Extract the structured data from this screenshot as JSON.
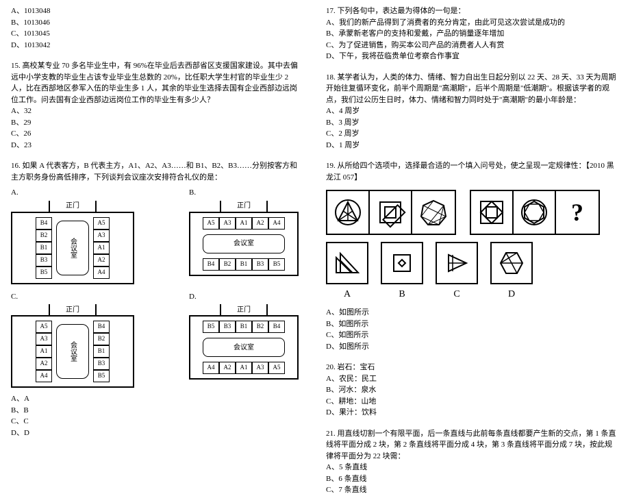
{
  "q14": {
    "opts": [
      "A、1013048",
      "B、1013046",
      "C、1013045",
      "D、1013042"
    ]
  },
  "q15": {
    "stem": "15. 高校某专业 70 多名毕业生中，有 96%在毕业后去西部省区支援国家建设。其中去偏远中小学支教的毕业生占该专业毕业生总数的 20%，比任职大学生村官的毕业生少 2 人，比在西部地区参军入伍的毕业生多 1 人，其余的毕业生选择去国有企业西部边远岗位工作。问去国有企业西部边远岗位工作的毕业生有多少人？",
    "opts": [
      "A、32",
      "B、29",
      "C、26",
      "D、23"
    ]
  },
  "q16": {
    "stem": "16. 如果 A 代表客方，B 代表主方，A1、A2、A3……和 B1、B2、B3……分别按客方和主方职务身份高低排序，下列谈判会议座次安排符合礼仪的是：",
    "labels": [
      "A.",
      "B.",
      "C.",
      "D."
    ],
    "gate": "正门",
    "room": "会议室",
    "layoutA": {
      "left": [
        "B4",
        "B2",
        "B1",
        "B3",
        "B5"
      ],
      "right": [
        "A5",
        "A3",
        "A1",
        "A2",
        "A4"
      ]
    },
    "layoutB": {
      "top": [
        "A5",
        "A3",
        "A1",
        "A2",
        "A4"
      ],
      "bottom": [
        "B4",
        "B2",
        "B1",
        "B3",
        "B5"
      ]
    },
    "layoutC": {
      "left": [
        "A5",
        "A3",
        "A1",
        "A2",
        "A4"
      ],
      "right": [
        "B4",
        "B2",
        "B1",
        "B3",
        "B5"
      ]
    },
    "layoutD": {
      "top": [
        "B5",
        "B3",
        "B1",
        "B2",
        "B4"
      ],
      "bottom": [
        "A4",
        "A2",
        "A1",
        "A3",
        "A5"
      ]
    },
    "opts": [
      "A、A",
      "B、B",
      "C、C",
      "D、D"
    ]
  },
  "q17": {
    "stem": "17. 下列各句中，表达最为得体的一句是：",
    "opts": [
      "A、我们的新产品得到了消费者的充分肯定，由此可见这次尝试是成功的",
      "B、承蒙新老客户的支持和爱戴，产品的销量逐年增加",
      "C、为了促进销售，购买本公司产品的消费者人人有赏",
      "D、下午，我将莅临贵单位考察合作事宜"
    ]
  },
  "q18": {
    "stem": "18. 某学者认为，人类的体力、情绪、智力自出生日起分别以 22 天、28 天、33 天为周期开始往复循环变化，前半个周期是\"高潮期\"，后半个周期是\"低潮期\"。根据该学者的观点，我们过公历生日时，体力、情绪和智力同时处于\"高潮期\"的最小年龄是：",
    "opts": [
      "A、4 周岁",
      "B、3 周岁",
      "C、2 周岁",
      "D、1 周岁"
    ]
  },
  "q19": {
    "stem": "19. 从所给四个选项中，选择最合适的一个填入问号处，使之呈现一定规律性：【2010 黑龙江 057】",
    "opts": [
      "A、如图所示",
      "B、如图所示",
      "C、如图所示",
      "D、如图所示"
    ],
    "answerLabels": [
      "A",
      "B",
      "C",
      "D"
    ]
  },
  "q20": {
    "stem": "20. 岩石：宝石",
    "opts": [
      "A、农民：民工",
      "B、河水：泉水",
      "C、耕地：山地",
      "D、果汁：饮料"
    ]
  },
  "q21": {
    "stem": "21. 用直线切割一个有限平面，后一条直线与此前每条直线都要产生新的交点，第 1 条直线将平面分成 2 块，第 2 条直线将平面分成 4 块，第 3 条直线将平面分成 7 块，按此规律将平面分为 22 块需：",
    "opts": [
      "A、5 条直线",
      "B、6 条直线",
      "C、7 条直线"
    ]
  }
}
